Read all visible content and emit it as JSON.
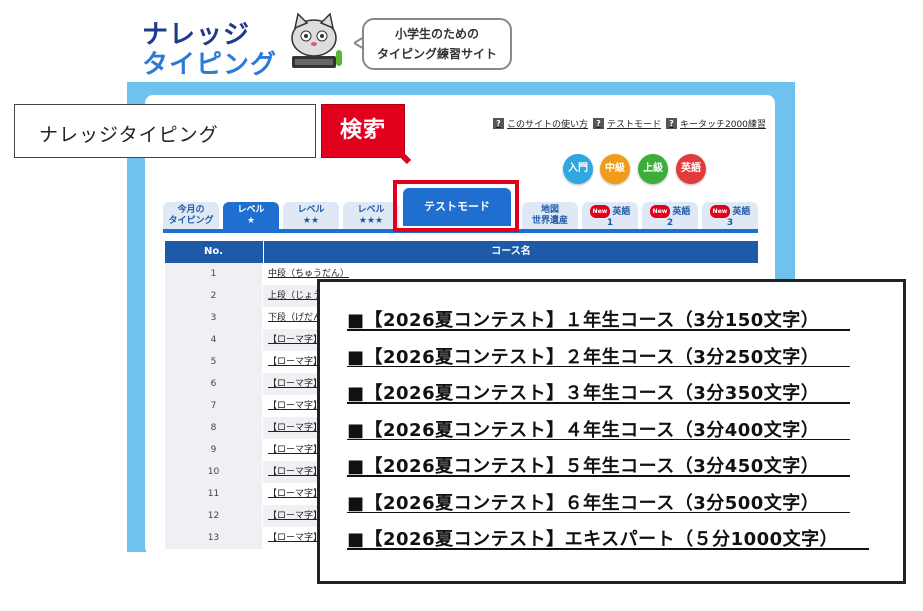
{
  "logo": {
    "line1": "ナレッジ",
    "line2": "タイピング",
    "tagline_line1": "小学生のための",
    "tagline_line2": "タイピング練習サイト"
  },
  "search": {
    "query": "ナレッジタイピング",
    "button_label": "検索"
  },
  "help_links": [
    {
      "label": "このサイトの使い方"
    },
    {
      "label": "テストモード"
    },
    {
      "label": "キータッチ2000練習"
    }
  ],
  "help_icon_glyph": "?",
  "levels": [
    {
      "label": "入門",
      "color": "#2fa7e0"
    },
    {
      "label": "中級",
      "color": "#f29a1a"
    },
    {
      "label": "上級",
      "color": "#3cae3a"
    },
    {
      "label": "英語",
      "color": "#e23b3b"
    }
  ],
  "tabs": [
    {
      "line1": "今月の",
      "line2": "タイピング"
    },
    {
      "line1": "レベル",
      "line2": "★"
    },
    {
      "line1": "レベル",
      "line2": "★★"
    },
    {
      "line1": "レベル",
      "line2": "★★★"
    },
    {
      "line1": "テストモード",
      "line2": ""
    },
    {
      "line1": "地図",
      "line2": "世界遺産"
    },
    {
      "line1": "英語",
      "line2": "1",
      "badge": "New"
    },
    {
      "line1": "英語",
      "line2": "2",
      "badge": "New"
    },
    {
      "line1": "英語",
      "line2": "3",
      "badge": "New"
    }
  ],
  "table": {
    "headers": {
      "no": "No.",
      "name": "コース名"
    },
    "rows": [
      {
        "no": "1",
        "name": "中段（ちゅうだん）"
      },
      {
        "no": "2",
        "name": "上段（じょう"
      },
      {
        "no": "3",
        "name": "下段（げだん"
      },
      {
        "no": "4",
        "name": "【ローマ字】"
      },
      {
        "no": "5",
        "name": "【ローマ字】"
      },
      {
        "no": "6",
        "name": "【ローマ字】"
      },
      {
        "no": "7",
        "name": "【ローマ字】"
      },
      {
        "no": "8",
        "name": "【ローマ字】"
      },
      {
        "no": "9",
        "name": "【ローマ字】"
      },
      {
        "no": "10",
        "name": "【ローマ字】"
      },
      {
        "no": "11",
        "name": "【ローマ字】"
      },
      {
        "no": "12",
        "name": "【ローマ字】"
      },
      {
        "no": "13",
        "name": "【ローマ字】"
      }
    ]
  },
  "contest_courses": [
    "■【2026夏コンテスト】１年生コース（3分150文字）",
    "■【2026夏コンテスト】２年生コース（3分250文字）",
    "■【2026夏コンテスト】３年生コース（3分350文字）",
    "■【2026夏コンテスト】４年生コース（3分400文字）",
    "■【2026夏コンテスト】５年生コース（3分450文字）",
    "■【2026夏コンテスト】６年生コース（3分500文字）",
    "■【2026夏コンテスト】エキスパート（５分1000文字）"
  ],
  "colors": {
    "frame": "#6fc1ee",
    "tab_active": "#1f6fd1",
    "highlight": "#e2001d",
    "search_button": "#e2001d"
  }
}
